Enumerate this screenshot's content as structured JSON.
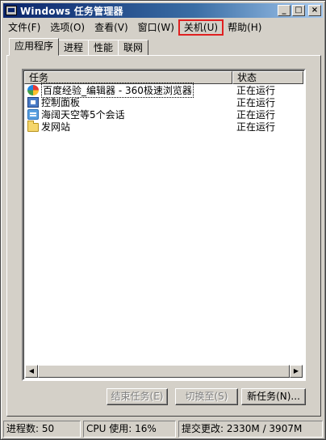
{
  "window": {
    "title": "Windows 任务管理器",
    "controls": {
      "minimize": "_",
      "restore": "□",
      "close": "×"
    }
  },
  "menu": [
    {
      "label": "文件(F)"
    },
    {
      "label": "选项(O)"
    },
    {
      "label": "查看(V)"
    },
    {
      "label": "窗口(W)"
    },
    {
      "label": "关机(U)",
      "highlighted": true
    },
    {
      "label": "帮助(H)"
    }
  ],
  "tabs": [
    {
      "label": "应用程序",
      "active": true
    },
    {
      "label": "进程"
    },
    {
      "label": "性能"
    },
    {
      "label": "联网"
    }
  ],
  "list": {
    "columns": {
      "name": "任务",
      "status": "状态"
    },
    "rows": [
      {
        "name": "百度经验_编辑器 - 360极速浏览器",
        "status": "正在运行",
        "icon": "browser-icon"
      },
      {
        "name": "控制面板",
        "status": "正在运行",
        "icon": "control-panel-icon"
      },
      {
        "name": "海阔天空等5个会话",
        "status": "正在运行",
        "icon": "chat-icon"
      },
      {
        "name": "发网站",
        "status": "正在运行",
        "icon": "folder-icon"
      }
    ]
  },
  "buttons": {
    "end_task": "结束任务(E)",
    "switch_to": "切换至(S)",
    "new_task": "新任务(N)..."
  },
  "status": {
    "processes": "进程数: 50",
    "cpu": "CPU 使用: 16%",
    "commit": "提交更改: 2330M / 3907M"
  },
  "colors": {
    "face": "#d4d0c8",
    "title_start": "#0a246a",
    "title_end": "#a6caf0",
    "highlight_box": "#e02020"
  }
}
